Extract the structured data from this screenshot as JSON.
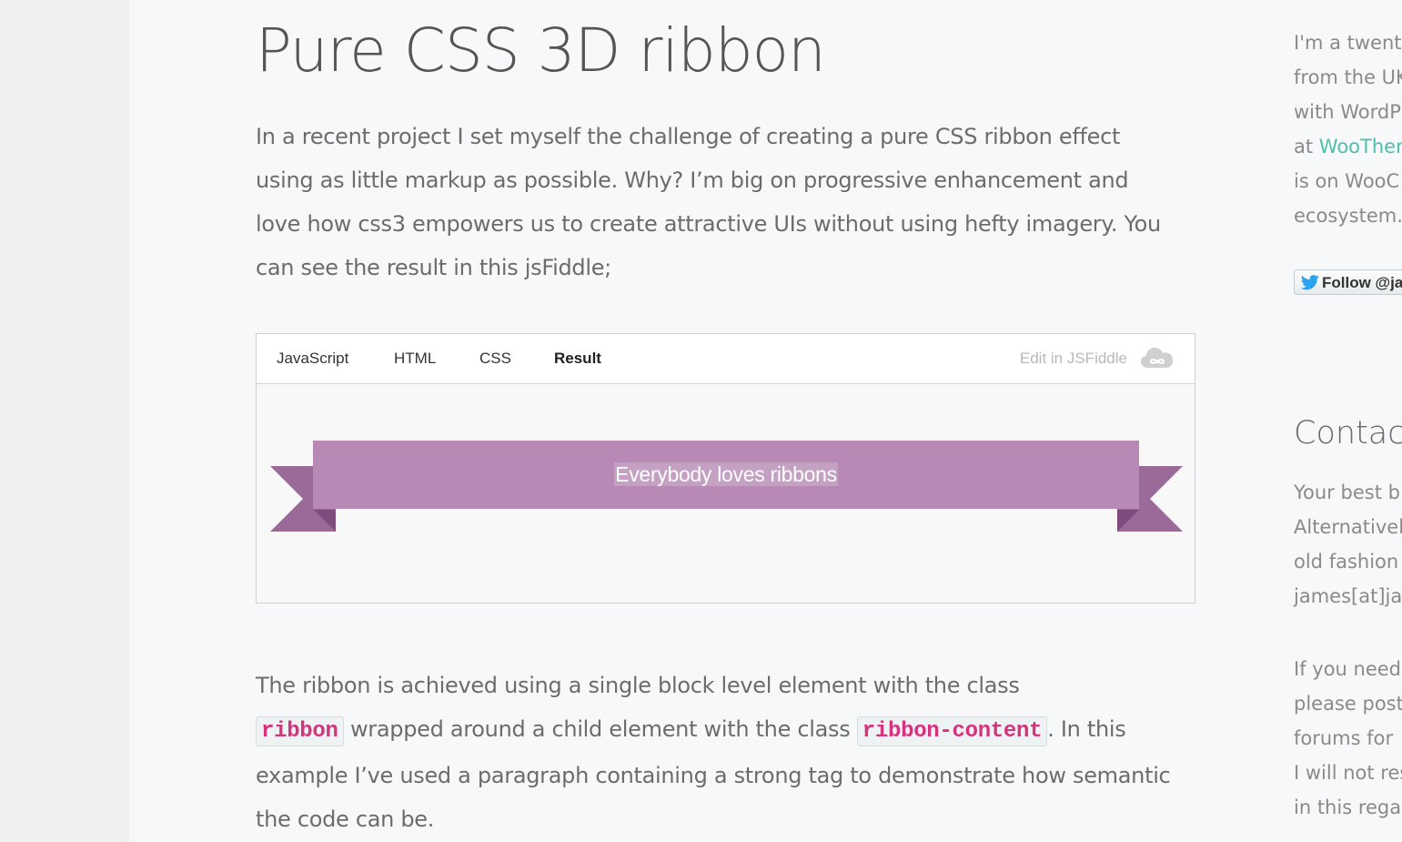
{
  "post": {
    "title": "Pure CSS 3D ribbon",
    "intro": "In a recent project I set myself the challenge of creating a pure CSS ribbon effect using as little markup as possible. Why? I’m big on progressive enhancement and love how css3 empowers us to create attractive UIs without using hefty imagery. You can see the result in this jsFiddle;",
    "body_part1": "The ribbon is achieved using a single block level element with the class",
    "code1": "ribbon",
    "body_part2": " wrapped around a child element with the class ",
    "code2": "ribbon-content",
    "body_part3": ". In this example I’ve used a paragraph containing a strong tag to demonstrate how semantic the code can be."
  },
  "fiddle": {
    "tabs": [
      {
        "label": "JavaScript"
      },
      {
        "label": "HTML"
      },
      {
        "label": "CSS"
      },
      {
        "label": "Result",
        "active": true
      }
    ],
    "edit_label": "Edit in JSFiddle",
    "cloud_icon": "cloud-icon",
    "ribbon_text": "Everybody loves ribbons",
    "colors": {
      "ribbon": "#b989b5",
      "ribbon_end": "#9c6a98",
      "ribbon_fold": "#7f4a7c",
      "text_highlight": "#c4a1c2"
    }
  },
  "sidebar": {
    "about_lines": [
      "I'm a twenty",
      "from the UK",
      "with WordP",
      "at ",
      "is on WooC",
      "ecosystem."
    ],
    "about_link": "WooThen",
    "follow_label": "Follow @ja",
    "contact_heading": "Contact",
    "contact_lines": [
      "Your best b",
      "Alternativel",
      "old fashion",
      "james[at]ja"
    ],
    "support_lines": [
      "If you need",
      "please post",
      "forums for",
      "I will not res",
      "in this rega"
    ],
    "link_color": "#4fbfad"
  }
}
